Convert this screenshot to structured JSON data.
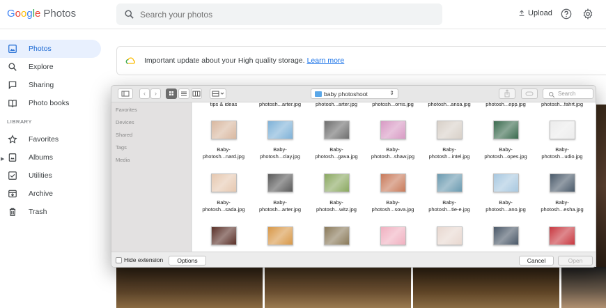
{
  "app": {
    "logo_prefix": "Google",
    "logo_product": "Photos",
    "search_placeholder": "Search your photos",
    "upload_label": "Upload"
  },
  "sidebar": {
    "items": [
      {
        "label": "Photos",
        "icon": "photo-icon"
      },
      {
        "label": "Explore",
        "icon": "search-icon"
      },
      {
        "label": "Sharing",
        "icon": "chat-icon"
      },
      {
        "label": "Photo books",
        "icon": "book-icon"
      }
    ],
    "library_label": "LIBRARY",
    "library_items": [
      {
        "label": "Favorites",
        "icon": "star-icon"
      },
      {
        "label": "Albums",
        "icon": "album-icon"
      },
      {
        "label": "Utilities",
        "icon": "checkbox-icon"
      },
      {
        "label": "Archive",
        "icon": "archive-icon"
      },
      {
        "label": "Trash",
        "icon": "trash-icon"
      }
    ]
  },
  "banner": {
    "text": "Important update about your High quality storage.",
    "link": "Learn more"
  },
  "dialog": {
    "folder": "baby photoshoot",
    "search_placeholder": "Search",
    "sidebar": [
      "Favorites",
      "Devices",
      "Shared",
      "Tags",
      "Media"
    ],
    "top_row_names": [
      "tips & ideas",
      "photosh...arter.jpg",
      "photosh...arter.jpg",
      "photosh...orris.jpg",
      "photosh...ansa.jpg",
      "photosh...epp.jpg",
      "photosh...fahrt.jpg"
    ],
    "rows": [
      {
        "files": [
          {
            "name1": "Baby-",
            "name2": "photosh...nard.jpg",
            "color": "#d9b8a0"
          },
          {
            "name1": "Baby-",
            "name2": "photosh...clay.jpg",
            "color": "#7fb2d8"
          },
          {
            "name1": "Baby-",
            "name2": "photosh...gava.jpg",
            "color": "#6e6e6e"
          },
          {
            "name1": "Baby-",
            "name2": "photosh...shaw.jpg",
            "color": "#d89ac4"
          },
          {
            "name1": "Baby-",
            "name2": "photosh...intel.jpg",
            "color": "#d8d0c8"
          },
          {
            "name1": "Baby-",
            "name2": "photosh...opes.jpg",
            "color": "#3a6a4e"
          },
          {
            "name1": "Baby-",
            "name2": "photosh...udio.jpg",
            "color": "#ececec"
          }
        ]
      },
      {
        "files": [
          {
            "name1": "Baby-",
            "name2": "photosh...sada.jpg",
            "color": "#e6c8b0"
          },
          {
            "name1": "Baby-",
            "name2": "photosh...arter.jpg",
            "color": "#5a5a5a"
          },
          {
            "name1": "Baby-",
            "name2": "photosh...witz.jpg",
            "color": "#8aa860"
          },
          {
            "name1": "Baby-",
            "name2": "photosh...sova.jpg",
            "color": "#c87a5a"
          },
          {
            "name1": "Baby-",
            "name2": "photosh...tie-e.jpg",
            "color": "#6a9ab0"
          },
          {
            "name1": "Baby-",
            "name2": "photosh...ano.jpg",
            "color": "#a8c8e0"
          },
          {
            "name1": "Baby-",
            "name2": "photosh...esha.jpg",
            "color": "#4a5a6a"
          }
        ]
      },
      {
        "files": [
          {
            "name1": "",
            "name2": "",
            "color": "#5a3028"
          },
          {
            "name1": "",
            "name2": "",
            "color": "#d89848"
          },
          {
            "name1": "",
            "name2": "",
            "color": "#8a7a5a"
          },
          {
            "name1": "",
            "name2": "",
            "color": "#f0b0c0"
          },
          {
            "name1": "",
            "name2": "",
            "color": "#e8d8d0"
          },
          {
            "name1": "",
            "name2": "",
            "color": "#4a5868"
          },
          {
            "name1": "",
            "name2": "",
            "color": "#c83840"
          }
        ]
      }
    ],
    "hide_extension_label": "Hide extension",
    "options_label": "Options",
    "cancel_label": "Cancel",
    "open_label": "Open"
  },
  "colors": {
    "accent": "#1a73e8",
    "active_nav_bg": "#e8f0fe"
  }
}
